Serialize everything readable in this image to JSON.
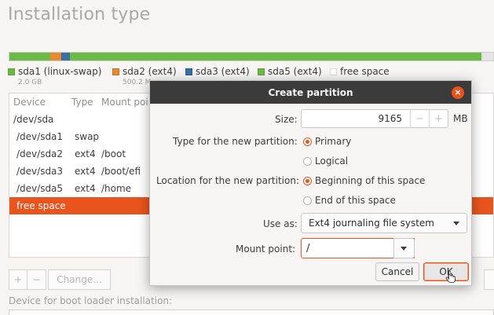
{
  "page": {
    "title": "Installation type"
  },
  "colors": {
    "accent": "#e9541e",
    "sda1": "#6cba45",
    "sda2": "#e38b2e",
    "sda3": "#3a6ea5",
    "sda5": "#6cba45",
    "free": "#ffffff"
  },
  "disk_bar": [
    {
      "name": "sda1",
      "fraction": 0.085,
      "color": "#6cba45"
    },
    {
      "name": "sda2",
      "fraction": 0.022,
      "color": "#e38b2e"
    },
    {
      "name": "sda3",
      "fraction": 0.018,
      "color": "#3a6ea5"
    },
    {
      "name": "sda5",
      "fraction": 0.85,
      "color": "#6cba45"
    },
    {
      "name": "free",
      "fraction": 0.025,
      "color": "#e4e4e4"
    }
  ],
  "legend": [
    {
      "label": "sda1 (linux-swap)",
      "size": "2.0 GB",
      "color": "#6cba45"
    },
    {
      "label": "sda2 (ext4)",
      "size": "500.2 M",
      "color": "#e38b2e"
    },
    {
      "label": "sda3 (ext4)",
      "size": "",
      "color": "#3a6ea5"
    },
    {
      "label": "sda5 (ext4)",
      "size": "",
      "color": "#6cba45"
    },
    {
      "label": "free space",
      "size": "",
      "color": "#ffffff"
    }
  ],
  "table": {
    "headers": {
      "device": "Device",
      "type": "Type",
      "mount": "Mount poi"
    },
    "rows": [
      {
        "device": "/dev/sda",
        "type": "",
        "mount": ""
      },
      {
        "device": "/dev/sda1",
        "type": "swap",
        "mount": ""
      },
      {
        "device": "/dev/sda2",
        "type": "ext4",
        "mount": "/boot"
      },
      {
        "device": "/dev/sda3",
        "type": "ext4",
        "mount": "/boot/efi"
      },
      {
        "device": "/dev/sda5",
        "type": "ext4",
        "mount": "/home"
      },
      {
        "device": "free space",
        "type": "",
        "mount": ""
      }
    ]
  },
  "toolbar": {
    "add": "+",
    "remove": "−",
    "change": "Change..."
  },
  "boot": {
    "label": "Device for boot loader installation:"
  },
  "dialog": {
    "title": "Create partition",
    "close_glyph": "×",
    "size_label": "Size:",
    "size_value": "9165",
    "size_minus": "−",
    "size_plus": "+",
    "size_unit": "MB",
    "type_label": "Type for the new partition:",
    "type_primary": "Primary",
    "type_logical": "Logical",
    "location_label": "Location for the new partition:",
    "location_begin": "Beginning of this space",
    "location_end": "End of this space",
    "useas_label": "Use as:",
    "useas_value": "Ext4 journaling file system",
    "mount_label": "Mount point:",
    "mount_value": "/",
    "cancel": "Cancel",
    "ok": "OK"
  }
}
